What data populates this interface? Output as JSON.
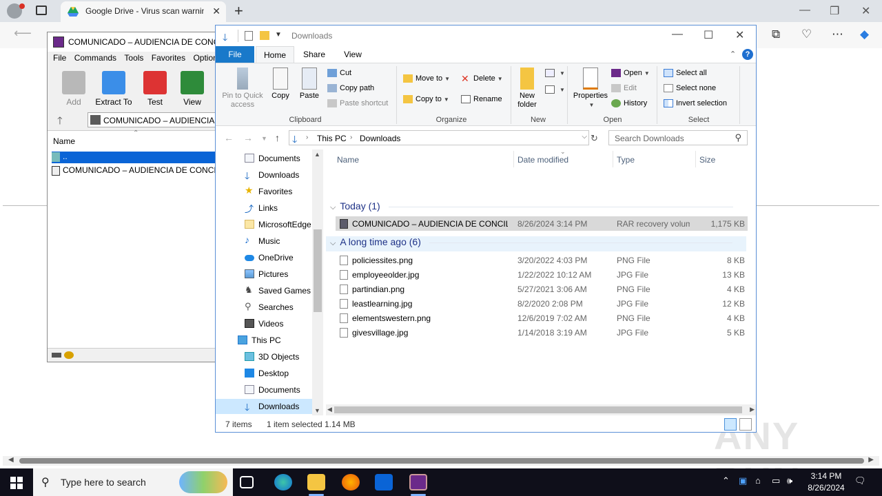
{
  "browser": {
    "tab_title": "Google Drive - Virus scan warning",
    "tab_close": "✕",
    "new_tab": "+",
    "min": "—",
    "max": "❐",
    "close": "✕"
  },
  "winrar": {
    "title": "COMUNICADO – AUDIENCIA DE CONCILIACION",
    "menu": [
      "File",
      "Commands",
      "Tools",
      "Favorites",
      "Options"
    ],
    "toolbar": [
      {
        "label": "Add",
        "icon": "add-archive-icon",
        "enabled": false
      },
      {
        "label": "Extract To",
        "icon": "extract-folder-icon",
        "enabled": true
      },
      {
        "label": "Test",
        "icon": "test-clipboard-icon",
        "enabled": true
      },
      {
        "label": "View",
        "icon": "view-book-icon",
        "enabled": true
      }
    ],
    "path": "COMUNICADO – AUDIENCIA DE CONCILIACION",
    "column_name": "Name",
    "rows": [
      {
        "name": "..",
        "selected": true
      },
      {
        "name": "COMUNICADO – AUDIENCIA DE CONCILIACION",
        "selected": false
      }
    ]
  },
  "explorer": {
    "title": "Downloads",
    "window_min": "—",
    "window_max": "☐",
    "window_close": "✕",
    "tabs": [
      "File",
      "Home",
      "Share",
      "View"
    ],
    "help": "?",
    "ribbon": {
      "clipboard": {
        "label": "Clipboard",
        "pin": "Pin to Quick access",
        "copy": "Copy",
        "paste": "Paste",
        "cut": "Cut",
        "copy_path": "Copy path",
        "paste_shortcut": "Paste shortcut"
      },
      "organize": {
        "label": "Organize",
        "move_to": "Move to",
        "copy_to": "Copy to",
        "delete": "Delete",
        "rename": "Rename"
      },
      "new": {
        "label": "New",
        "new_folder": "New folder"
      },
      "open": {
        "label": "Open",
        "properties": "Properties",
        "open": "Open",
        "edit": "Edit",
        "history": "History"
      },
      "select": {
        "label": "Select",
        "select_all": "Select all",
        "select_none": "Select none",
        "invert": "Invert selection"
      }
    },
    "address": {
      "crumbs": [
        "This PC",
        "Downloads"
      ]
    },
    "search_placeholder": "Search Downloads",
    "nav": [
      {
        "label": "Documents",
        "icon": "documents-icon",
        "level": 2
      },
      {
        "label": "Downloads",
        "icon": "downloads-icon",
        "level": 2
      },
      {
        "label": "Favorites",
        "icon": "star-icon",
        "level": 2
      },
      {
        "label": "Links",
        "icon": "links-icon",
        "level": 2
      },
      {
        "label": "MicrosoftEdge",
        "icon": "folder-icon",
        "level": 2
      },
      {
        "label": "Music",
        "icon": "music-icon",
        "level": 2
      },
      {
        "label": "OneDrive",
        "icon": "onedrive-icon",
        "level": 2
      },
      {
        "label": "Pictures",
        "icon": "pictures-icon",
        "level": 2
      },
      {
        "label": "Saved Games",
        "icon": "saved-games-icon",
        "level": 2
      },
      {
        "label": "Searches",
        "icon": "search-icon",
        "level": 2
      },
      {
        "label": "Videos",
        "icon": "videos-icon",
        "level": 2
      },
      {
        "label": "This PC",
        "icon": "computer-icon",
        "level": 1
      },
      {
        "label": "3D Objects",
        "icon": "3d-objects-icon",
        "level": 2
      },
      {
        "label": "Desktop",
        "icon": "desktop-icon",
        "level": 2
      },
      {
        "label": "Documents",
        "icon": "documents-icon",
        "level": 2
      },
      {
        "label": "Downloads",
        "icon": "downloads-icon",
        "level": 2,
        "selected": true
      }
    ],
    "columns": {
      "name": "Name",
      "date": "Date modified",
      "type": "Type",
      "size": "Size"
    },
    "groups": [
      {
        "label": "Today (1)",
        "files": [
          {
            "name": "COMUNICADO – AUDIENCIA DE CONCILIACION",
            "date": "8/26/2024 3:14 PM",
            "type": "RAR recovery volume",
            "size": "1,175 KB",
            "selected": true,
            "rar": true
          }
        ]
      },
      {
        "label": "A long time ago (6)",
        "files": [
          {
            "name": "policiessites.png",
            "date": "3/20/2022 4:03 PM",
            "type": "PNG File",
            "size": "8 KB"
          },
          {
            "name": "employeeolder.jpg",
            "date": "1/22/2022 10:12 AM",
            "type": "JPG File",
            "size": "13 KB"
          },
          {
            "name": "partindian.png",
            "date": "5/27/2021 3:06 AM",
            "type": "PNG File",
            "size": "4 KB"
          },
          {
            "name": "leastlearning.jpg",
            "date": "8/2/2020 2:08 PM",
            "type": "JPG File",
            "size": "12 KB"
          },
          {
            "name": "elementswestern.png",
            "date": "12/6/2019 7:02 AM",
            "type": "PNG File",
            "size": "4 KB"
          },
          {
            "name": "givesvillage.jpg",
            "date": "1/14/2018 3:19 AM",
            "type": "JPG File",
            "size": "5 KB"
          }
        ]
      }
    ],
    "status": {
      "items": "7 items",
      "selected": "1 item selected",
      "size": "1.14 MB"
    }
  },
  "taskbar": {
    "search_placeholder": "Type here to search",
    "time": "3:14 PM",
    "date": "8/26/2024"
  },
  "watermark": "ANY RUN"
}
